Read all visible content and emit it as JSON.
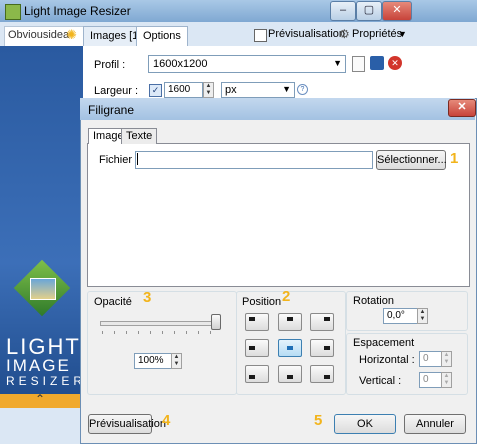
{
  "main_window": {
    "title": "Light Image Resizer",
    "controls": [
      "–",
      "▢",
      "✕"
    ],
    "logo_text": "Obviousidea",
    "tabs": [
      {
        "label": "Images [1]"
      },
      {
        "label": "Options"
      }
    ],
    "preview_label": "Prévisualisation",
    "properties_label": "Propriétés",
    "profile_label": "Profil :",
    "profile_value": "1600x1200",
    "width_label": "Largeur :",
    "width_value": "1600",
    "unit_value": "px",
    "banner_words": [
      "LIGHT",
      "IMAGE",
      "RESIZER"
    ],
    "banner_arrow": "⌃"
  },
  "dialog": {
    "title": "Filigrane",
    "close": "✕",
    "tabs": [
      {
        "label": "Image"
      },
      {
        "label": "Texte"
      }
    ],
    "file_label": "Fichier :",
    "file_value": "",
    "select_button": "Sélectionner...",
    "opacity": {
      "label": "Opacité",
      "value": "100%",
      "level": 1.0
    },
    "position": {
      "label": "Position",
      "selected": "center"
    },
    "rotation": {
      "label": "Rotation",
      "value": "0,0°"
    },
    "spacing": {
      "label": "Espacement",
      "horizontal_label": "Horizontal :",
      "horizontal_value": "0",
      "vertical_label": "Vertical :",
      "vertical_value": "0"
    },
    "preview_button": "Prévisualisation",
    "ok_button": "OK",
    "cancel_button": "Annuler"
  },
  "callouts": [
    "1",
    "2",
    "3",
    "4",
    "5"
  ],
  "colors": {
    "accent": "#f2b41c",
    "title_bar": "#a3c2e2",
    "close": "#c7433a"
  }
}
